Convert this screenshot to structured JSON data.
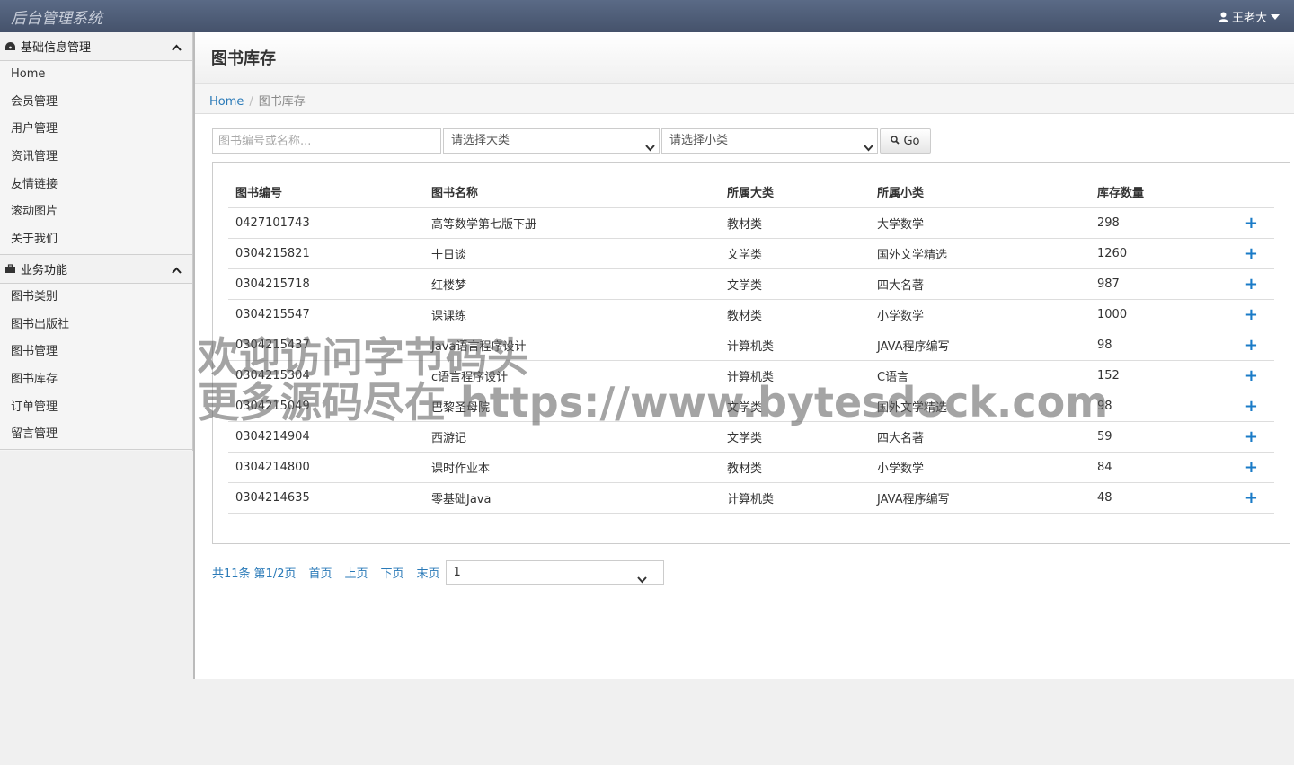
{
  "header": {
    "brand": "后台管理系统",
    "user": "王老大"
  },
  "sidebar": {
    "sections": [
      {
        "title": "基础信息管理",
        "items": [
          "Home",
          "会员管理",
          "用户管理",
          "资讯管理",
          "友情链接",
          "滚动图片",
          "关于我们"
        ]
      },
      {
        "title": "业务功能",
        "items": [
          "图书类别",
          "图书出版社",
          "图书管理",
          "图书库存",
          "订单管理",
          "留言管理"
        ]
      }
    ]
  },
  "page": {
    "title": "图书库存",
    "breadcrumb": {
      "home": "Home",
      "current": "图书库存"
    }
  },
  "filters": {
    "search_placeholder": "图书编号或名称...",
    "category": "请选择大类",
    "subcategory": "请选择小类",
    "go_label": "Go"
  },
  "table": {
    "headers": [
      "图书编号",
      "图书名称",
      "所属大类",
      "所属小类",
      "库存数量"
    ],
    "rows": [
      [
        "0427101743",
        "高等数学第七版下册",
        "教材类",
        "大学数学",
        "298"
      ],
      [
        "0304215821",
        "十日谈",
        "文学类",
        "国外文学精选",
        "1260"
      ],
      [
        "0304215718",
        "红楼梦",
        "文学类",
        "四大名著",
        "987"
      ],
      [
        "0304215547",
        "课课练",
        "教材类",
        "小学数学",
        "1000"
      ],
      [
        "0304215437",
        "Java语言程序设计",
        "计算机类",
        "JAVA程序编写",
        "98"
      ],
      [
        "0304215304",
        "c语言程序设计",
        "计算机类",
        "C语言",
        "152"
      ],
      [
        "0304215049",
        "巴黎圣母院",
        "文学类",
        "国外文学精选",
        "98"
      ],
      [
        "0304214904",
        "西游记",
        "文学类",
        "四大名著",
        "59"
      ],
      [
        "0304214800",
        "课时作业本",
        "教材类",
        "小学数学",
        "84"
      ],
      [
        "0304214635",
        "零基础Java",
        "计算机类",
        "JAVA程序编写",
        "48"
      ]
    ],
    "action_symbol": "+"
  },
  "pager": {
    "total": "共11条",
    "pages": "第1/2页",
    "first": "首页",
    "prev": "上页",
    "next": "下页",
    "last": "末页",
    "current_page": "1"
  },
  "watermark": {
    "line1": "欢迎访问字节码头",
    "line2": "更多源码尽在 https://www.bytesdock.com"
  }
}
